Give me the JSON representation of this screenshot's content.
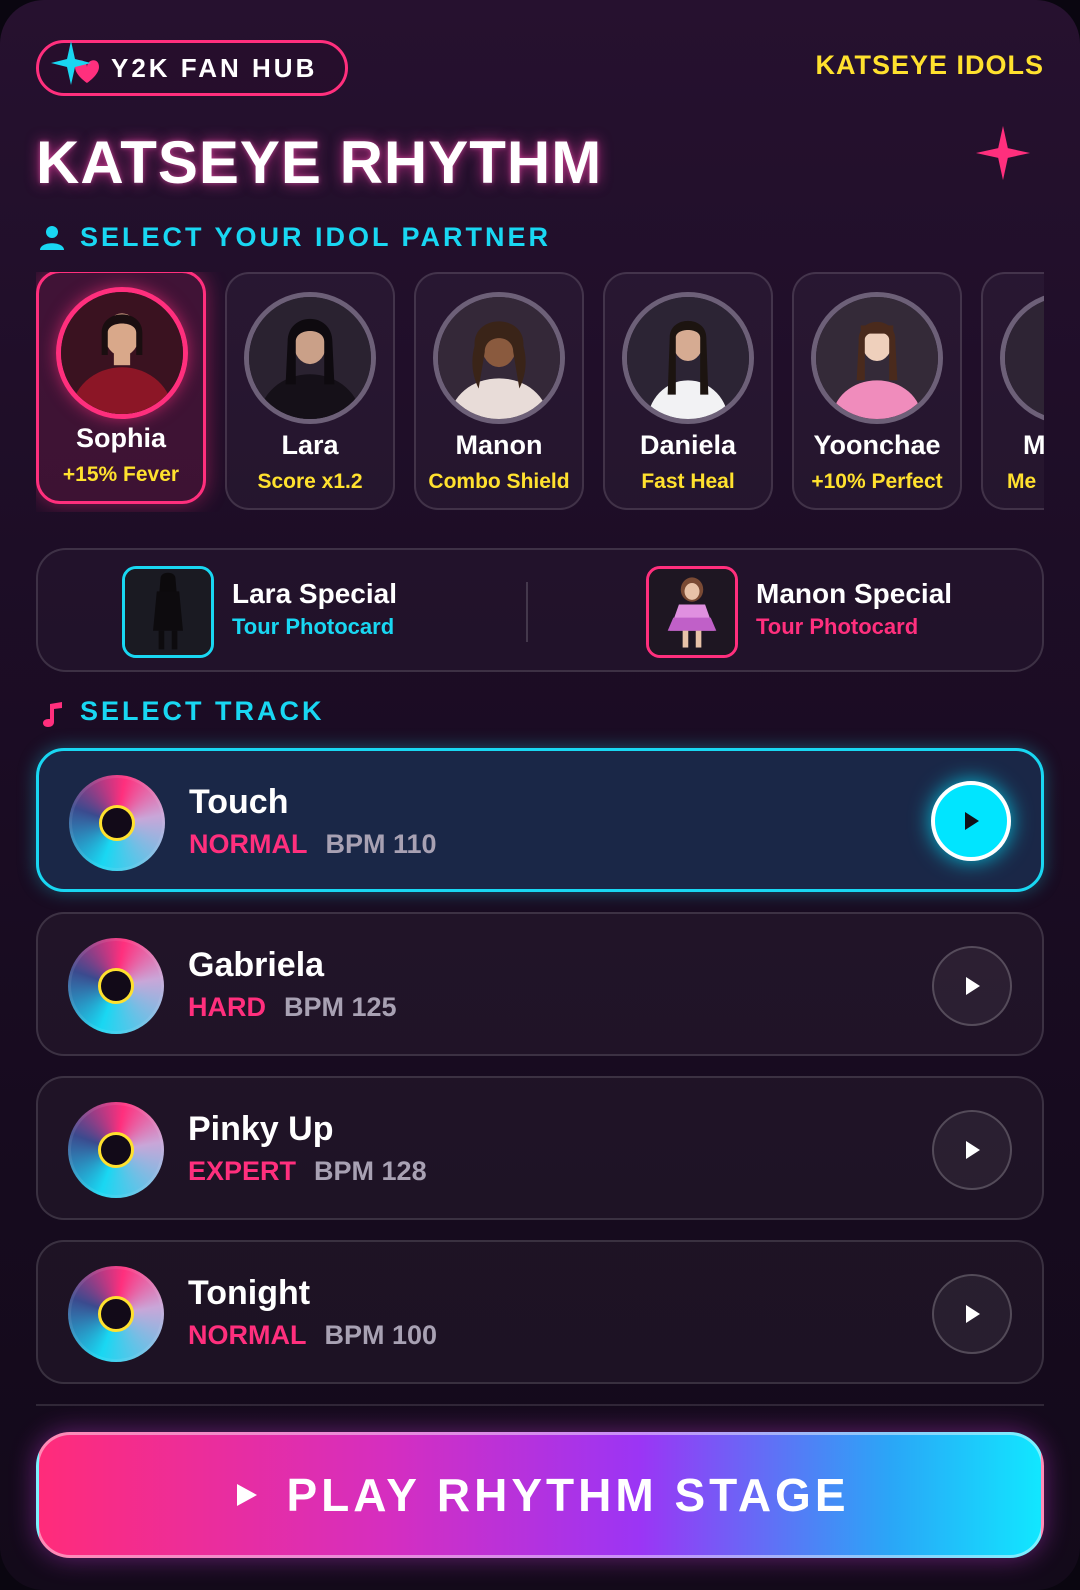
{
  "header": {
    "hub_label": "Y2K FAN HUB",
    "idols_link": "KATSEYE IDOLS",
    "title": "KATSEYE RHYTHM"
  },
  "idol_section": {
    "label": "SELECT YOUR IDOL PARTNER",
    "idols": [
      {
        "name": "Sophia",
        "perk": "+15% Fever",
        "selected": true
      },
      {
        "name": "Lara",
        "perk": "Score x1.2"
      },
      {
        "name": "Manon",
        "perk": "Combo Shield"
      },
      {
        "name": "Daniela",
        "perk": "Fast Heal"
      },
      {
        "name": "Yoonchae",
        "perk": "+10% Perfect"
      },
      {
        "name": "M",
        "perk": "Me"
      }
    ]
  },
  "photocards": [
    {
      "title": "Lara Special",
      "subtitle": "Tour Photocard",
      "accent": "#19d7f2"
    },
    {
      "title": "Manon Special",
      "subtitle": "Tour Photocard",
      "accent": "#ff2f7d"
    }
  ],
  "track_section": {
    "label": "SELECT TRACK",
    "tracks": [
      {
        "title": "Touch",
        "difficulty": "NORMAL",
        "bpm": "BPM 110",
        "active": true
      },
      {
        "title": "Gabriela",
        "difficulty": "HARD",
        "bpm": "BPM 125"
      },
      {
        "title": "Pinky Up",
        "difficulty": "EXPERT",
        "bpm": "BPM 128"
      },
      {
        "title": "Tonight",
        "difficulty": "NORMAL",
        "bpm": "BPM 100"
      }
    ]
  },
  "cta": {
    "label": "PLAY RHYTHM STAGE"
  },
  "colors": {
    "pink": "#ff2f7d",
    "cyan": "#19d7f2",
    "yellow": "#ffe12e",
    "background": "#1d0d26"
  },
  "icons": {
    "hub": "sparkle-heart-icon",
    "sparkle": "sparkle-icon",
    "person": "person-icon",
    "music": "music-note-icon",
    "play": "play-icon"
  }
}
